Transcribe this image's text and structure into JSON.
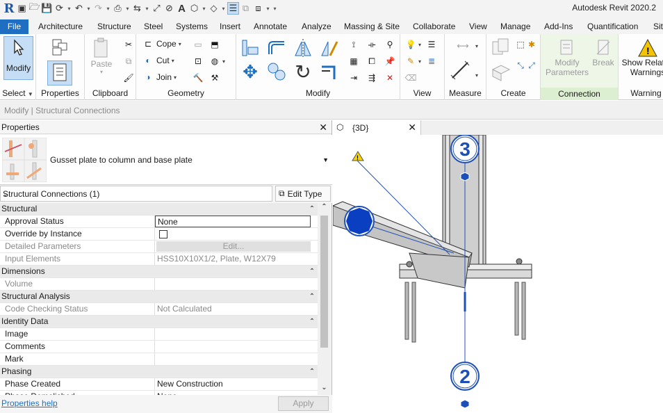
{
  "app": {
    "title": "Autodesk Revit 2020.2",
    "logo_letter": "R"
  },
  "ribbon_tabs": [
    "File",
    "Architecture",
    "Structure",
    "Steel",
    "Systems",
    "Insert",
    "Annotate",
    "Analyze",
    "Massing & Site",
    "Collaborate",
    "View",
    "Manage",
    "Add-Ins",
    "Quantification",
    "Site"
  ],
  "ribbon": {
    "select": {
      "modify": "Modify",
      "panel": "Select"
    },
    "properties": {
      "btn": "Properties",
      "panel": "Properties"
    },
    "clipboard": {
      "paste": "Paste",
      "panel": "Clipboard"
    },
    "geometry": {
      "cope": "Cope",
      "cut": "Cut",
      "join": "Join",
      "panel": "Geometry"
    },
    "modify": {
      "panel": "Modify"
    },
    "view": {
      "panel": "View"
    },
    "measure": {
      "panel": "Measure"
    },
    "create": {
      "panel": "Create"
    },
    "connection": {
      "modify_params_1": "Modify",
      "modify_params_2": "Parameters",
      "break": "Break",
      "panel": "Connection"
    },
    "warning": {
      "btn_1": "Show Related",
      "btn_2": "Warnings",
      "panel": "Warning"
    }
  },
  "context_bar": "Modify | Structural Connections",
  "properties": {
    "header": "Properties",
    "type_name": "Gusset plate to column and base plate",
    "filter": "Structural Connections (1)",
    "edit_type": "Edit Type",
    "groups": [
      {
        "name": "Structural",
        "rows": [
          {
            "name": "Approval Status",
            "value": "None",
            "kind": "edit"
          },
          {
            "name": "Override by Instance",
            "value": "",
            "kind": "check"
          },
          {
            "name": "Detailed Parameters",
            "value": "Edit...",
            "kind": "button"
          },
          {
            "name": "Input Elements",
            "value": "HSS10X10X1/2, Plate, W12X79",
            "kind": "readonly"
          }
        ]
      },
      {
        "name": "Dimensions",
        "rows": [
          {
            "name": "Volume",
            "value": "",
            "kind": "readonly"
          }
        ]
      },
      {
        "name": "Structural Analysis",
        "rows": [
          {
            "name": "Code Checking Status",
            "value": "Not Calculated",
            "kind": "readonly"
          }
        ]
      },
      {
        "name": "Identity Data",
        "rows": [
          {
            "name": "Image",
            "value": "",
            "kind": "text"
          },
          {
            "name": "Comments",
            "value": "",
            "kind": "text"
          },
          {
            "name": "Mark",
            "value": "",
            "kind": "text"
          }
        ]
      },
      {
        "name": "Phasing",
        "rows": [
          {
            "name": "Phase Created",
            "value": "New Construction",
            "kind": "text"
          },
          {
            "name": "Phase Demolished",
            "value": "None",
            "kind": "text"
          }
        ]
      }
    ],
    "help_link": "Properties help",
    "apply": "Apply"
  },
  "view": {
    "tab_label": "{3D}",
    "grid_bubbles": [
      "3",
      "2"
    ]
  },
  "colors": {
    "file_tab": "#1e6fc2",
    "grid_blue": "#1d4fb8",
    "connection_panel": "#dcefd0"
  }
}
